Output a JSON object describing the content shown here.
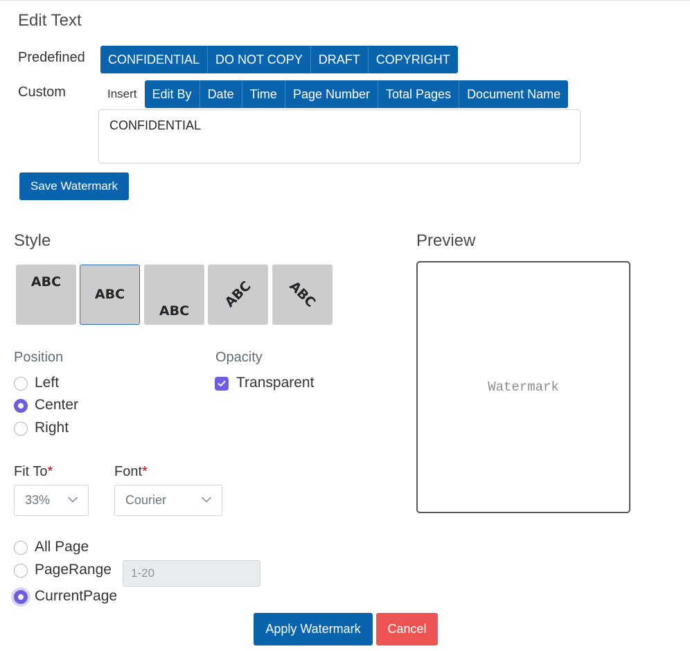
{
  "dialog": {
    "title": "Edit Text"
  },
  "predefined": {
    "label": "Predefined",
    "options": [
      "CONFIDENTIAL",
      "DO NOT COPY",
      "DRAFT",
      "COPYRIGHT"
    ]
  },
  "custom": {
    "label": "Custom",
    "insert_label": "Insert",
    "insert_options": [
      "Edit By",
      "Date",
      "Time",
      "Page Number",
      "Total Pages",
      "Document Name"
    ],
    "text_value": "CONFIDENTIAL"
  },
  "save_button": "Save Watermark",
  "style": {
    "title": "Style",
    "tiles": [
      {
        "text": "ABC",
        "variant": "top"
      },
      {
        "text": "ABC",
        "variant": "middle",
        "selected": true
      },
      {
        "text": "ABC",
        "variant": "bottom"
      },
      {
        "text": "ABC",
        "variant": "diagonal-up"
      },
      {
        "text": "ABC",
        "variant": "diagonal-down"
      }
    ]
  },
  "position": {
    "label": "Position",
    "options": [
      "Left",
      "Center",
      "Right"
    ],
    "selected": "Center"
  },
  "opacity": {
    "label": "Opacity",
    "option": "Transparent",
    "checked": true
  },
  "fit_to": {
    "label": "Fit To",
    "required_mark": "*",
    "value": "33%"
  },
  "font": {
    "label": "Font",
    "required_mark": "*",
    "value": "Courier"
  },
  "pages": {
    "options": [
      "All Page",
      "PageRange",
      "CurrentPage"
    ],
    "selected": "CurrentPage",
    "range_placeholder": "1-20"
  },
  "preview": {
    "title": "Preview",
    "text": "Watermark"
  },
  "actions": {
    "apply": "Apply Watermark",
    "cancel": "Cancel"
  },
  "colors": {
    "primary": "#0a64ad",
    "accent": "#6d5ee0",
    "danger": "#ec5353"
  },
  "icons": {
    "dropdown": "chevron-down-icon",
    "checkbox": "check-icon"
  }
}
